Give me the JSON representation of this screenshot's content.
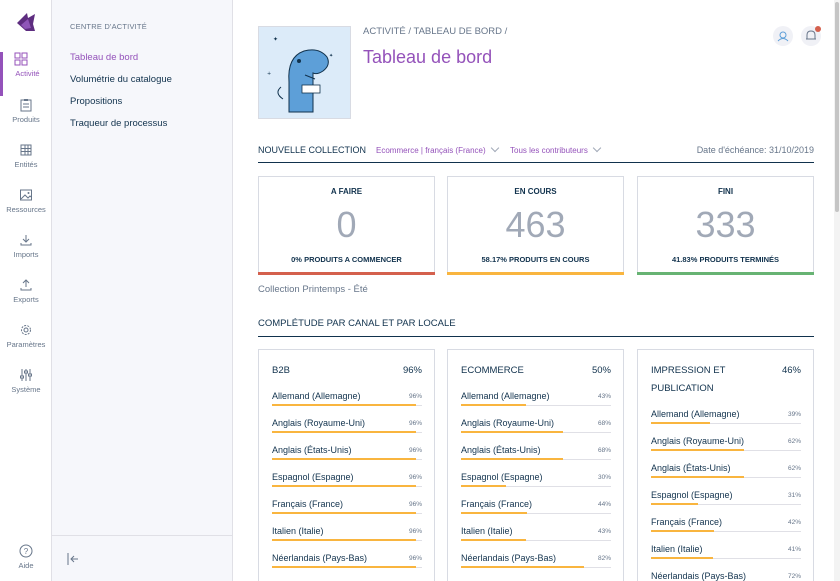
{
  "nav": {
    "items": [
      {
        "id": "activite",
        "label": "Activité",
        "icon": "grid-icon",
        "active": true
      },
      {
        "id": "produits",
        "label": "Produits",
        "icon": "clipboard-icon"
      },
      {
        "id": "entites",
        "label": "Entités",
        "icon": "table-icon"
      },
      {
        "id": "ressources",
        "label": "Ressources",
        "icon": "image-icon"
      },
      {
        "id": "imports",
        "label": "Imports",
        "icon": "import-icon"
      },
      {
        "id": "exports",
        "label": "Exports",
        "icon": "export-icon"
      },
      {
        "id": "parametres",
        "label": "Paramètres",
        "icon": "gear-icon"
      },
      {
        "id": "systeme",
        "label": "Système",
        "icon": "sliders-icon"
      }
    ],
    "help": "Aide"
  },
  "subnav": {
    "title": "CENTRE D'ACTIVITÉ",
    "items": [
      {
        "label": "Tableau de bord",
        "active": true
      },
      {
        "label": "Volumétrie du catalogue"
      },
      {
        "label": "Propositions"
      },
      {
        "label": "Traqueur de processus"
      }
    ]
  },
  "header": {
    "breadcrumb": "ACTIVITÉ / TABLEAU DE BORD /",
    "title": "Tableau de bord"
  },
  "filters": {
    "label": "NOUVELLE COLLECTION",
    "channel_locale": "Ecommerce | français (France)",
    "contributors": "Tous les contributeurs",
    "due_date": "Date d'échéance: 31/10/2019"
  },
  "stats": [
    {
      "title": "A FAIRE",
      "value": "0",
      "subtitle": "0% PRODUITS A COMMENCER",
      "color": "#d4604d"
    },
    {
      "title": "EN COURS",
      "value": "463",
      "subtitle": "58.17% PRODUITS EN COURS",
      "color": "#f9b53f"
    },
    {
      "title": "FINI",
      "value": "333",
      "subtitle": "41.83% PRODUITS TERMINÉS",
      "color": "#67b373"
    }
  ],
  "collection_name": "Collection Printemps - Été",
  "completeness_title": "COMPLÉTUDE PAR CANAL ET PAR LOCALE",
  "channels": [
    {
      "name": "B2B",
      "percent": "96%",
      "locales": [
        {
          "name": "Allemand (Allemagne)",
          "percent": "96%",
          "value": 96
        },
        {
          "name": "Anglais (Royaume-Uni)",
          "percent": "96%",
          "value": 96
        },
        {
          "name": "Anglais (États-Unis)",
          "percent": "96%",
          "value": 96
        },
        {
          "name": "Espagnol (Espagne)",
          "percent": "96%",
          "value": 96
        },
        {
          "name": "Français (France)",
          "percent": "96%",
          "value": 96
        },
        {
          "name": "Italien (Italie)",
          "percent": "96%",
          "value": 96
        },
        {
          "name": "Néerlandais (Pays-Bas)",
          "percent": "96%",
          "value": 96
        }
      ]
    },
    {
      "name": "ECOMMERCE",
      "percent": "50%",
      "locales": [
        {
          "name": "Allemand (Allemagne)",
          "percent": "43%",
          "value": 43
        },
        {
          "name": "Anglais (Royaume-Uni)",
          "percent": "68%",
          "value": 68
        },
        {
          "name": "Anglais (États-Unis)",
          "percent": "68%",
          "value": 68
        },
        {
          "name": "Espagnol (Espagne)",
          "percent": "30%",
          "value": 30
        },
        {
          "name": "Français (France)",
          "percent": "44%",
          "value": 44
        },
        {
          "name": "Italien (Italie)",
          "percent": "43%",
          "value": 43
        },
        {
          "name": "Néerlandais (Pays-Bas)",
          "percent": "82%",
          "value": 82
        }
      ]
    },
    {
      "name": "IMPRESSION ET PUBLICATION",
      "percent": "46%",
      "locales": [
        {
          "name": "Allemand (Allemagne)",
          "percent": "39%",
          "value": 39
        },
        {
          "name": "Anglais (Royaume-Uni)",
          "percent": "62%",
          "value": 62
        },
        {
          "name": "Anglais (États-Unis)",
          "percent": "62%",
          "value": 62
        },
        {
          "name": "Espagnol (Espagne)",
          "percent": "31%",
          "value": 31
        },
        {
          "name": "Français (France)",
          "percent": "42%",
          "value": 42
        },
        {
          "name": "Italien (Italie)",
          "percent": "41%",
          "value": 41
        },
        {
          "name": "Néerlandais (Pays-Bas)",
          "percent": "72%",
          "value": 72
        }
      ]
    }
  ],
  "colors": {
    "accent": "#9452ba",
    "text": "#11324d",
    "muted": "#67768a",
    "progress": "#f9b53f"
  }
}
